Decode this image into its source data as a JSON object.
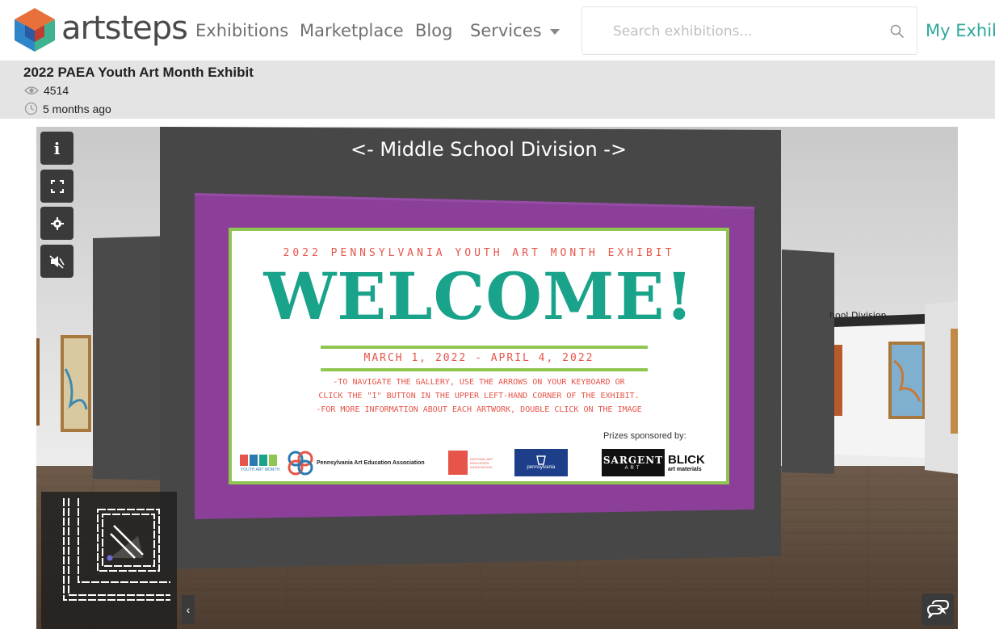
{
  "brand": {
    "name": "artsteps"
  },
  "nav": {
    "items": [
      "Exhibitions",
      "Marketplace",
      "Blog",
      "Services"
    ],
    "my_exhibitions": "My Exhib"
  },
  "search": {
    "placeholder": "Search exhibitions..."
  },
  "exhibition": {
    "title": "2022 PAEA Youth Art Month Exhibit",
    "views": "4514",
    "posted": "5 months ago"
  },
  "scene": {
    "division_title": "<- Middle School Division ->",
    "side_label": "hool Division",
    "poster": {
      "subtitle": "2022 PENNSYLVANIA YOUTH ART MONTH EXHIBIT",
      "headline": "WELCOME!",
      "dates": "MARCH 1, 2022 - APRIL 4, 2022",
      "instructions": [
        "-TO NAVIGATE THE GALLERY, USE THE ARROWS ON YOUR KEYBOARD OR",
        "CLICK THE \"I\" BUTTON IN THE UPPER LEFT-HAND CORNER OF THE EXHIBIT.",
        "-FOR MORE INFORMATION ABOUT EACH ARTWORK, DOUBLE CLICK ON THE IMAGE"
      ],
      "prizes_label": "Prizes sponsored by:",
      "sponsors": {
        "yam": "YOUTH ART MONTH",
        "paea": "Pennsylvania Art Education Association",
        "naea": "NATIONAL ART EDUCATION ASSOCIATION",
        "pa": "pennsylvania",
        "sargent": "SARGENT",
        "sargent_sub": "ART",
        "blick": "BLICK",
        "blick_sub": "art materials"
      }
    }
  },
  "controls": {
    "info_label": "i",
    "collapse_label": "‹"
  },
  "colors": {
    "accent": "#2fa89c",
    "poster_frame": "#8b3f99",
    "welcome": "#1aa38b",
    "poster_text": "#e6554a",
    "poster_border": "#8fc651"
  }
}
